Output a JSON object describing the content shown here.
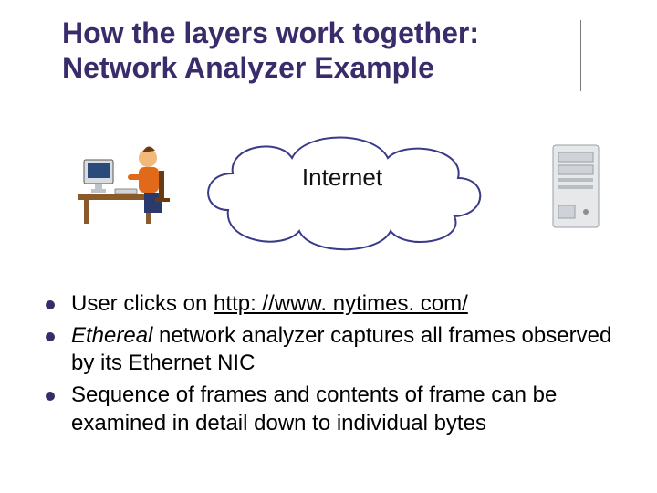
{
  "title_line1": "How the layers work together:",
  "title_line2": "Network Analyzer Example",
  "diagram": {
    "cloud_label": "Internet",
    "user_icon": "user-at-computer-icon",
    "server_icon": "server-tower-icon"
  },
  "bullets": {
    "b1_pre": "User clicks on ",
    "b1_link": "http: //www. nytimes. com/",
    "b2_ital": "Ethereal",
    "b2_rest": " network analyzer captures all frames observed by its Ethernet NIC",
    "b3": "Sequence of frames and contents of frame can be examined in detail down to individual bytes"
  },
  "colors": {
    "title": "#3a2b6a",
    "bullet": "#3a2b6a"
  }
}
